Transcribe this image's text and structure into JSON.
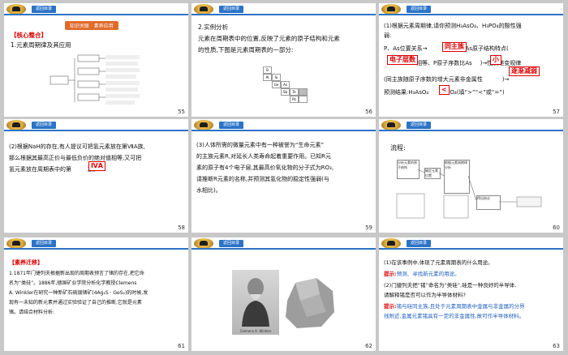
{
  "header_button": "返回目录",
  "slide55": {
    "top_banner": "知识关联 · 素养应用",
    "heading": "【核心整合】",
    "line1": "1.元素周期律及其应用",
    "page": "55"
  },
  "slide56": {
    "line1": "2.实例分析",
    "line2": "元素在周期表中的位置,反映了元素的原子结构和元素",
    "line3": "的性质,下图是元素周期表的一部分:",
    "table_cells": [
      "B",
      "",
      "",
      "",
      "Al",
      "Si",
      "",
      "",
      "",
      "Ge",
      "As",
      "",
      "",
      "",
      "Sb",
      "Te",
      "",
      "",
      "",
      "",
      "Po",
      ""
    ],
    "page": "56"
  },
  "slide57": {
    "line1": "(1)根据元素周期律,请你预测H₃AsO₄、H₃PO₄的酸性强",
    "line2": "弱:",
    "line3": "P、As位置关系→",
    "line3b": "→P、As原子结构特点(",
    "line4b": "相等、P原子序数比As",
    "line4c": ")→性质递变规律",
    "line5": "(同主族随原子序数的增大元素非金属性",
    "line5b": ")→",
    "line6": "预测结果:H₃AsO₄",
    "line6b": "H₃PO₄(填“>”“<”或“=”)",
    "tag_same_group": "同主族",
    "tag_shells": "电子层数",
    "tag_small": "小",
    "tag_weaken": "逐渐减弱",
    "tag_lt": "<",
    "page": "57"
  },
  "slide58": {
    "line1": "(2)根据NaH的存在,有人提议可把氢元素放在第ⅦA族,",
    "line2": "那么根据其最高正价与最低负价的绝对值相等,又可把",
    "line3": "氢元素放在周期表中的第",
    "line3b": "族。",
    "tag_answer": "ⅣA",
    "page": "58"
  },
  "slide59": {
    "line1": "(3)人体所需的微量元素中有一种被誉为“生命元素”",
    "line2": "的主族元素R,对延长人类寿命起着重要作用。已知R元",
    "line3": "素的原子有4个电子层,其最高价氧化物的分子式为RO₃,",
    "line4": "请推断R元素的名称,并预测其氢化物的稳定性强弱(与",
    "line5": "水相比)。",
    "page": "59"
  },
  "slide60": {
    "heading": "流程:",
    "box1": "分析元素的原子结构",
    "box2": "确定元素位置",
    "box3": "根据元素周期律分析",
    "box4": "得出结论",
    "page": "60"
  },
  "slide61": {
    "heading": "【素养迁移】",
    "line1": "1.1871年门捷列夫根据新出现的周期表预言了锗的存在,把它命",
    "line2": "名为“类硅”。1886年,德国矿业学院分析化学教授Clemens",
    "line3": "A. Winkler在研究一种新矿石硫银锗矿(4Ag₂S · GeS₂)的时候,发",
    "line4": "现有一未知的新元素并通过实验验证了自己的推断,它就是元素",
    "line5": "锗。请结合材料分析:",
    "page": "61"
  },
  "slide62": {
    "caption": "Clemens A. Winkler",
    "page": "62"
  },
  "slide63": {
    "line1": "(1)在该事例中,体现了元素周期表的什么用途。",
    "line2a": "提示:",
    "line2b": "预测、寻找新元素的用途。",
    "line3": "(2)门捷列夫把“锗”命名为“类硅”,硅是一种良好的半导体,",
    "line4": "请解释锗是否可以作为半导体材料?",
    "line5a": "提示:",
    "line5b": "锗与硅同主族,且处于元素周期表中金属与非金属的分界",
    "line6": "线附近,金属元素锗具有一定的非金属性,故可作半导体材料。",
    "page": "63"
  }
}
